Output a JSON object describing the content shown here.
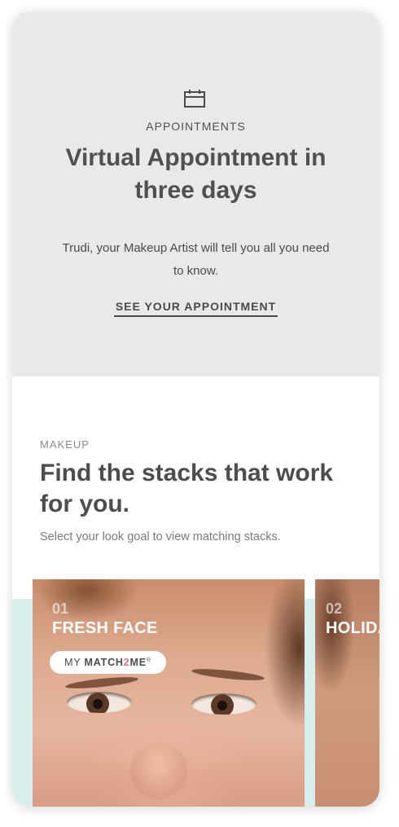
{
  "appointment": {
    "icon": "calendar-icon",
    "eyebrow": "APPOINTMENTS",
    "title": "Virtual Appointment in three days",
    "body": "Trudi, your Makeup Artist will tell you all you need to know.",
    "link_label": "SEE YOUR APPOINTMENT"
  },
  "makeup": {
    "eyebrow": "MAKEUP",
    "title": "Find the stacks that work for you.",
    "subtitle": "Select your look goal to view matching stacks.",
    "looks": [
      {
        "number": "01",
        "name": "FRESH FACE",
        "badge": {
          "prefix": "MY",
          "brand_a": "MATCH",
          "brand_accent": "2",
          "brand_b": "ME",
          "mark": "®"
        }
      },
      {
        "number": "02",
        "name": "HOLIDAY"
      }
    ]
  },
  "colors": {
    "appointment_bg": "#e9e9e9",
    "mint_band": "#d8eeec",
    "badge_accent": "#e26f80"
  }
}
